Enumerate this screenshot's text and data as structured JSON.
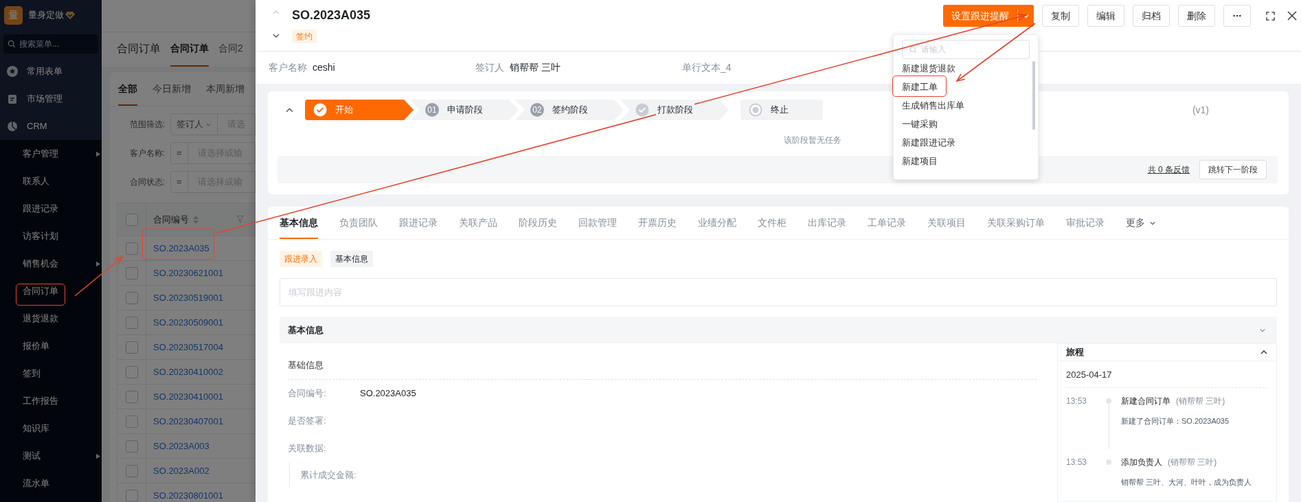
{
  "sidebar": {
    "logo_char": "量",
    "brand": "量身定做",
    "search_placeholder": "搜索菜单...",
    "groups": [
      {
        "label": "常用表单"
      },
      {
        "label": "市场管理"
      },
      {
        "label": "CRM"
      }
    ],
    "items": [
      {
        "label": "客户管理",
        "has_submenu": true
      },
      {
        "label": "联系人",
        "has_submenu": false
      },
      {
        "label": "跟进记录",
        "has_submenu": false
      },
      {
        "label": "访客计划",
        "has_submenu": false
      },
      {
        "label": "销售机会",
        "has_submenu": true
      },
      {
        "label": "合同订单",
        "has_submenu": false
      },
      {
        "label": "退货退款",
        "has_submenu": false
      },
      {
        "label": "报价单",
        "has_submenu": false
      },
      {
        "label": "签到",
        "has_submenu": false
      },
      {
        "label": "工作报告",
        "has_submenu": false
      },
      {
        "label": "知识库",
        "has_submenu": false
      },
      {
        "label": "测试",
        "has_submenu": true
      },
      {
        "label": "流水单",
        "has_submenu": false
      }
    ]
  },
  "list_page": {
    "title": "合同订单",
    "tabs": [
      {
        "label": "合同订单",
        "selected": true
      },
      {
        "label": "合同2",
        "selected": false
      }
    ],
    "views": [
      {
        "label": "全部",
        "selected": true
      },
      {
        "label": "今日新增",
        "selected": false
      },
      {
        "label": "本周新增",
        "selected": false
      }
    ],
    "filters": [
      {
        "label": "范围筛选:",
        "operator": "签订人",
        "placeholder": "请选"
      },
      {
        "label": "客户名称:",
        "operator": "=",
        "placeholder": "请选择或输"
      },
      {
        "label": "合同状态:",
        "operator": "=",
        "placeholder": "请选择或输"
      }
    ],
    "select_all_checked": false,
    "column": "合同编号",
    "rows": [
      {
        "number": "SO.2023A035",
        "checked": false
      },
      {
        "number": "SO.20230621001",
        "checked": false
      },
      {
        "number": "SO.20230519001",
        "checked": false
      },
      {
        "number": "SO.20230509001",
        "checked": false
      },
      {
        "number": "SO.20230517004",
        "checked": false
      },
      {
        "number": "SO.20230410002",
        "checked": false
      },
      {
        "number": "SO.20230410001",
        "checked": false
      },
      {
        "number": "SO.20230407001",
        "checked": false
      },
      {
        "number": "SO.2023A003",
        "checked": false
      },
      {
        "number": "SO.2023A002",
        "checked": false
      },
      {
        "number": "SO.20230801001",
        "checked": false
      }
    ]
  },
  "detail": {
    "title": "SO.2023A035",
    "status_tag": "签约",
    "primary_action": "设置跟进提醒",
    "buttons": [
      "复制",
      "编辑",
      "归档",
      "删除"
    ],
    "fields": [
      {
        "label": "客户名称",
        "value": "ceshi"
      },
      {
        "label": "签订人",
        "value": "销帮帮 三叶"
      },
      {
        "label": "单行文本_4"
      }
    ],
    "stages": [
      {
        "kind": "start",
        "label": "开始",
        "selected": true
      },
      {
        "kind": "numbered",
        "number": "01",
        "label": "申请阶段",
        "selected": false
      },
      {
        "kind": "numbered",
        "number": "02",
        "label": "签约阶段",
        "selected": false
      },
      {
        "kind": "check",
        "label": "打款阶段",
        "selected": false
      },
      {
        "kind": "end",
        "label": "终止",
        "selected": false
      }
    ],
    "version": "(v1)",
    "empty_text": "该阶段暂无任务",
    "feedback_link": "共 0 条反馈",
    "next_stage_button": "跳转下一阶段",
    "tabs": [
      {
        "label": "基本信息",
        "selected": true
      },
      {
        "label": "负责团队",
        "selected": false
      },
      {
        "label": "跟进记录",
        "selected": false
      },
      {
        "label": "关联产品",
        "selected": false
      },
      {
        "label": "阶段历史",
        "selected": false
      },
      {
        "label": "回款管理",
        "selected": false
      },
      {
        "label": "开票历史",
        "selected": false
      },
      {
        "label": "业绩分配",
        "selected": false
      },
      {
        "label": "文件柜",
        "selected": false
      },
      {
        "label": "出库记录",
        "selected": false
      },
      {
        "label": "工单记录",
        "selected": false
      },
      {
        "label": "关联项目",
        "selected": false
      },
      {
        "label": "关联采购订单",
        "selected": false
      },
      {
        "label": "审批记录",
        "selected": false
      }
    ],
    "more_tab": "更多",
    "sub_tabs": [
      {
        "label": "跟进录入",
        "selected": true
      },
      {
        "label": "基本信息",
        "selected": false
      }
    ],
    "followup_input": {
      "placeholder": "填写跟进内容"
    },
    "section_title": "基本信息",
    "group_title": "基础信息",
    "form_fields": [
      {
        "label": "合同编号:",
        "value": "SO.2023A035"
      },
      {
        "label": "是否签署:"
      },
      {
        "label": "关联数据:"
      }
    ],
    "nested_field": {
      "label": "累计成交金额:"
    },
    "journey": {
      "title": "旅程",
      "date": "2025-04-17",
      "events": [
        {
          "time": "13:53",
          "title": "新建合同订单",
          "actor": "(销帮帮 三叶)",
          "detail": "新建了合同订单：SO.2023A035"
        },
        {
          "time": "13:53",
          "title": "添加负责人",
          "actor": "(销帮帮 三叶)",
          "detail": "销帮帮 三叶、大河、叶叶，成为负责人"
        }
      ]
    }
  },
  "dropdown": {
    "search_placeholder": "请输入",
    "items": [
      "新建退货退款",
      "新建工单",
      "生成销售出库单",
      "一键采购",
      "新建跟进记录",
      "新建项目"
    ]
  }
}
